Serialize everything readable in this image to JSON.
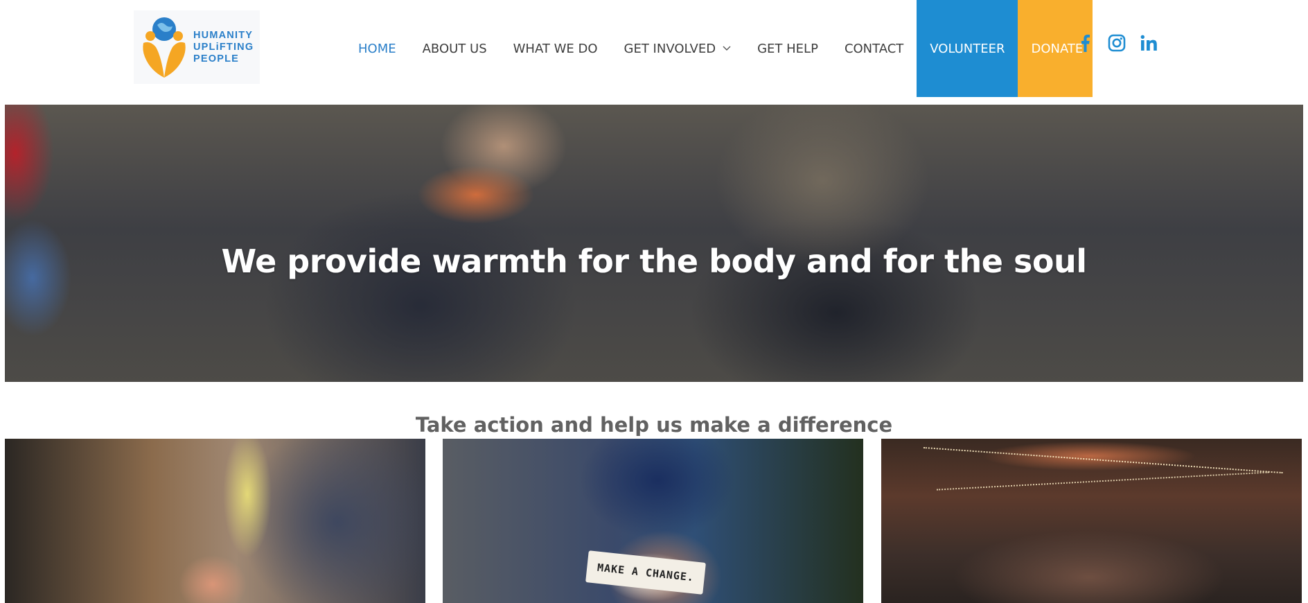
{
  "brand": {
    "logo_lines": [
      "HUMANITY",
      "UPLiFTING",
      "PEOPLE"
    ],
    "colors": {
      "blue": "#1e8dd2",
      "orange": "#f9af2d",
      "text_dark": "#3d3d3d",
      "accent": "#2a7fc9"
    }
  },
  "nav": {
    "items": [
      {
        "label": "HOME",
        "active": true
      },
      {
        "label": "ABOUT US"
      },
      {
        "label": "WHAT WE DO"
      },
      {
        "label": "GET INVOLVED",
        "has_dropdown": true
      },
      {
        "label": "GET HELP"
      },
      {
        "label": "CONTACT"
      }
    ],
    "volunteer_label": "VOLUNTEER",
    "donate_label": "DONATE"
  },
  "social": [
    {
      "icon": "facebook-icon"
    },
    {
      "icon": "instagram-icon"
    },
    {
      "icon": "linkedin-icon"
    }
  ],
  "hero": {
    "title": "We provide warmth for the body and for the soul"
  },
  "section": {
    "subtitle": "Take action and help us make a difference"
  },
  "cards": [
    {
      "icon": "high-five-photo"
    },
    {
      "icon": "make-a-change-photo",
      "note": "MAKE A CHANGE."
    },
    {
      "icon": "crowd-gathering-photo"
    }
  ]
}
